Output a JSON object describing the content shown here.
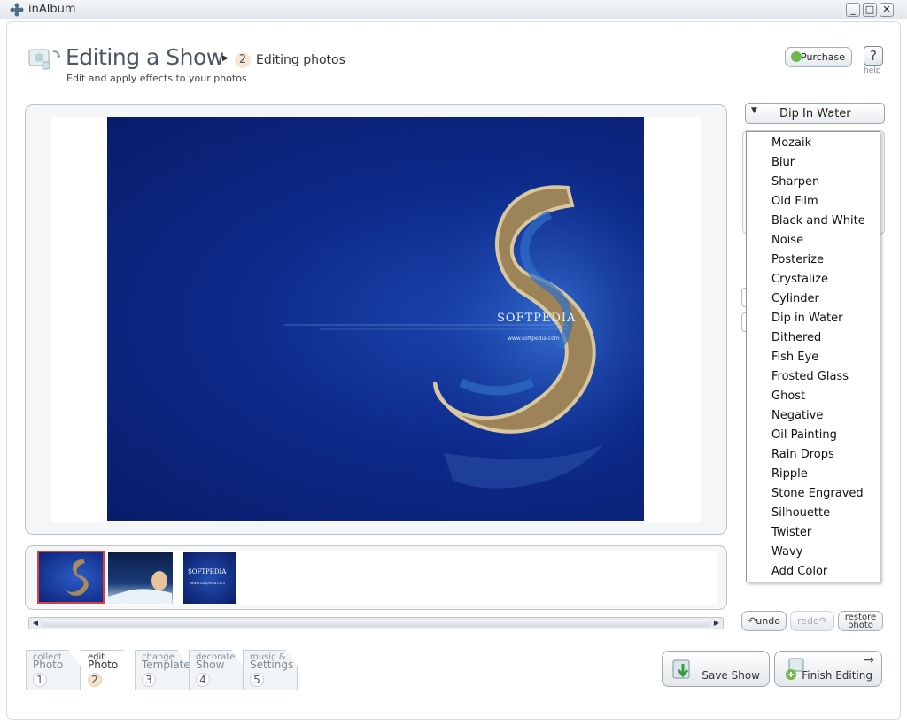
{
  "window": {
    "title": "inAlbum",
    "controls": [
      "_",
      "□",
      "✕"
    ]
  },
  "header": {
    "title": "Editing a Show",
    "step_number": "2",
    "step_label": "Editing photos",
    "subtitle": "Edit and apply effects to your photos",
    "purchase_label": "Purchase",
    "help_glyph": "?",
    "help_label": "help"
  },
  "photo": {
    "watermark": "SOFTPEDIA",
    "url_text": "www.softpedia.com"
  },
  "thumbnails": [
    {
      "name": "island-s",
      "selected": true
    },
    {
      "name": "woman-water",
      "selected": false
    },
    {
      "name": "softpedia-blue",
      "selected": false
    }
  ],
  "effects": {
    "selected": "Dip In Water",
    "options": [
      "Mozaik",
      "Blur",
      "Sharpen",
      "Old Film",
      "Black and White",
      "Noise",
      "Posterize",
      "Crystalize",
      "Cylinder",
      "Dip in Water",
      "Dithered",
      "Fish Eye",
      "Frosted Glass",
      "Ghost",
      "Negative",
      "Oil Painting",
      "Rain Drops",
      "Ripple",
      "Stone Engraved",
      "Silhouette",
      "Twister",
      "Wavy",
      "Add Color"
    ]
  },
  "edit_buttons": {
    "undo": "undo",
    "redo": "redo",
    "restore_line1": "restore",
    "restore_line2": "photo"
  },
  "tabs": [
    {
      "line1": "collect",
      "line2": "Photo",
      "num": "1",
      "active": false
    },
    {
      "line1": "edit",
      "line2": "Photo",
      "num": "2",
      "active": true
    },
    {
      "line1": "change",
      "line2": "Template",
      "num": "3",
      "active": false
    },
    {
      "line1": "decorate",
      "line2": "Show",
      "num": "4",
      "active": false
    },
    {
      "line1": "music &",
      "line2": "Settings",
      "num": "5",
      "active": false
    }
  ],
  "actions": {
    "save": "Save Show",
    "finish": "Finish Editing"
  },
  "colors": {
    "accent_selected": "#e23b3b",
    "photo_blue": "#0d2a8a",
    "step_badge": "#f6e2cc"
  }
}
